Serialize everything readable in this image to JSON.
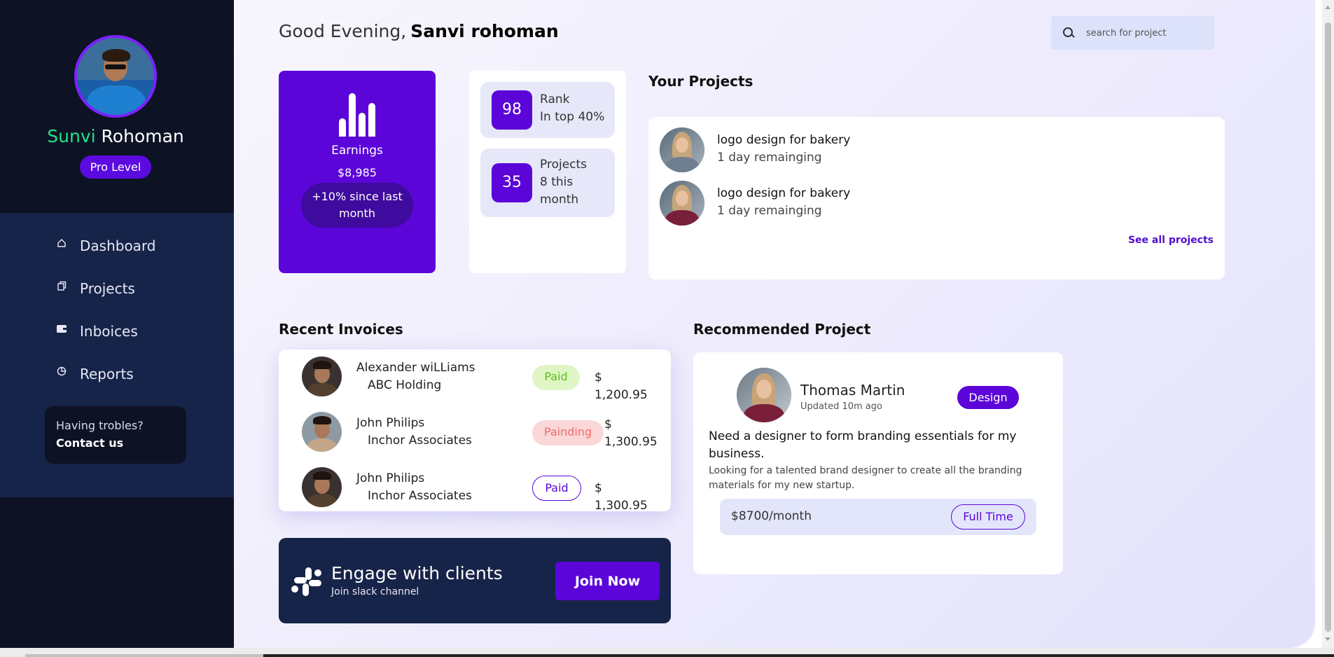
{
  "profile": {
    "first_name": "Sunvi",
    "last_name": "Rohoman",
    "level": "Pro Level"
  },
  "nav": {
    "items": [
      {
        "label": "Dashboard",
        "icon": "home-icon"
      },
      {
        "label": "Projects",
        "icon": "copy-icon"
      },
      {
        "label": "Inboices",
        "icon": "wallet-icon"
      },
      {
        "label": "Reports",
        "icon": "pie-chart-icon"
      }
    ]
  },
  "help": {
    "line1": "Having trobles?",
    "line2": "Contact us"
  },
  "header": {
    "greeting": "Good Evening,",
    "user_name": "Sanvi rohoman"
  },
  "search": {
    "placeholder": "search for project"
  },
  "earnings": {
    "label": "Earnings",
    "value": "$8,985",
    "change": "+10% since last month"
  },
  "stats": {
    "rank": {
      "number": "98",
      "label": "Rank",
      "sub": "In top 40%"
    },
    "projects": {
      "number": "35",
      "label": "Projects",
      "sub": "8 this month"
    }
  },
  "your_projects": {
    "title": "Your Projects",
    "items": [
      {
        "name": "logo design for bakery",
        "remaining": "1 day remainging"
      },
      {
        "name": "logo design for bakery",
        "remaining": "1 day remainging"
      }
    ],
    "see_all": "See all projects"
  },
  "invoices": {
    "title": "Recent Invoices",
    "rows": [
      {
        "name": "Alexander wiLLiams",
        "company": "ABC Holding",
        "status": "Paid",
        "amount": "$ 1,200.95"
      },
      {
        "name": "John Philips",
        "company": "Inchor Associates",
        "status": "Painding",
        "amount": "$ 1,300.95"
      },
      {
        "name": "John Philips",
        "company": "Inchor Associates",
        "status": "Paid",
        "amount": "$ 1,300.95"
      }
    ]
  },
  "engage": {
    "title": "Engage with clients",
    "subtitle": "Join slack channel",
    "button": "Join Now"
  },
  "recommended": {
    "title": "Recommended Project",
    "person": "Thomas Martin",
    "updated": "Updated 10m ago",
    "tag": "Design",
    "headline": "Need a designer to form branding essentials for my business.",
    "description": "Looking for a talented brand designer to create all the branding materials for my new startup.",
    "salary": "$8700/month",
    "type": "Full Time"
  },
  "colors": {
    "sidebar_dark": "#0d1224",
    "sidebar_nav": "#172449",
    "accent_purple": "#5b05d8",
    "name_green": "#1fe38a",
    "paid_green": "#5abf1b",
    "pending_red": "#f06b6b"
  }
}
